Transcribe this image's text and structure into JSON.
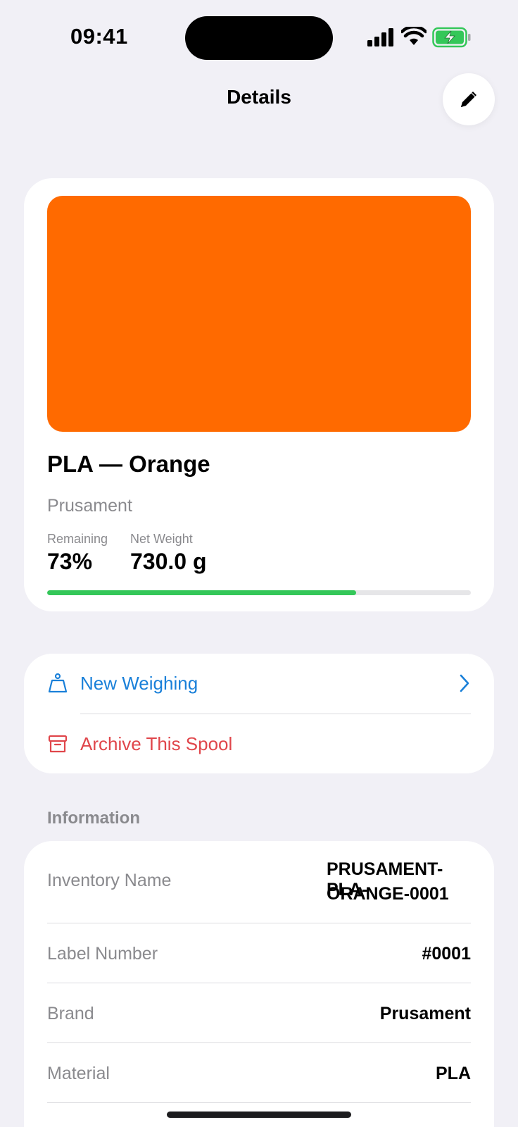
{
  "status_bar": {
    "time": "09:41"
  },
  "nav": {
    "title": "Details",
    "edit_icon": "pencil-icon"
  },
  "spool": {
    "color_hex": "#ff6a00",
    "title": "PLA — Orange",
    "brand": "Prusament",
    "remaining_label": "Remaining",
    "remaining_value": "73%",
    "remaining_fraction": 0.73,
    "net_weight_label": "Net Weight",
    "net_weight_value": "730.0 g"
  },
  "actions": {
    "new_weighing": {
      "label": "New Weighing",
      "icon": "scale-icon"
    },
    "archive": {
      "label": "Archive This Spool",
      "icon": "archive-box-icon"
    }
  },
  "information": {
    "header": "Information",
    "rows": [
      {
        "key": "Inventory Name",
        "value_line1": "PRUSAMENT-PLA-",
        "value_line2": "ORANGE-0001"
      },
      {
        "key": "Label Number",
        "value": "#0001"
      },
      {
        "key": "Brand",
        "value": "Prusament"
      },
      {
        "key": "Material",
        "value": "PLA"
      }
    ]
  },
  "colors": {
    "accent": "#1a80d9",
    "destructive": "#e0464b",
    "progress": "#34c759",
    "background": "#f1f0f6"
  }
}
